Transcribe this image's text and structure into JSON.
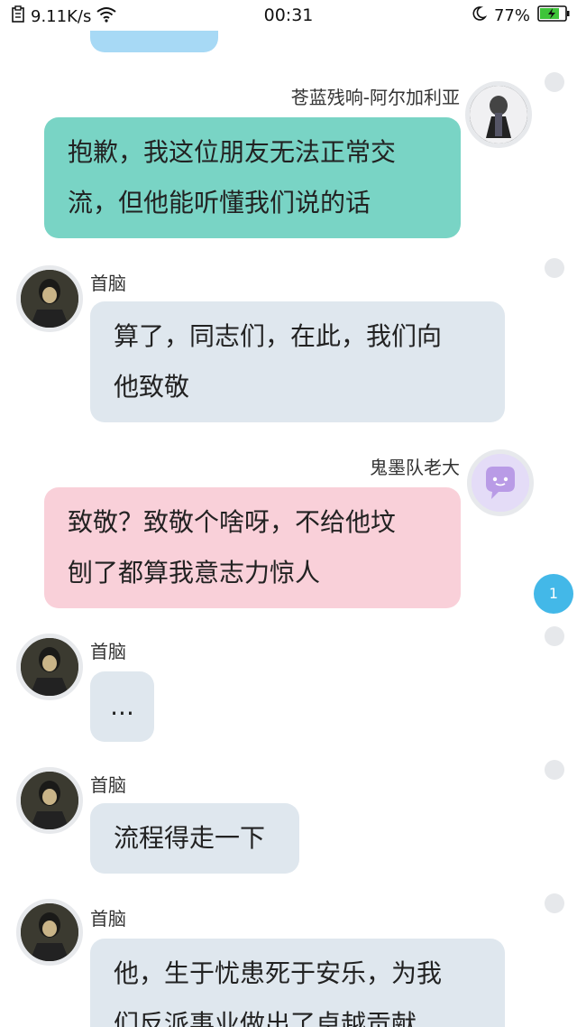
{
  "status_bar": {
    "net_speed": "9.11K/s",
    "time": "00:31",
    "battery": "77%"
  },
  "messages": [
    {
      "text": "",
      "sender": ""
    },
    {
      "sender": "苍蓝残响-阿尔加利亚",
      "line1": "抱歉，我这位朋友无法正常交",
      "line2": "流，但他能听懂我们说的话"
    },
    {
      "sender": "首脑",
      "line1": "算了，同志们，在此，我们向",
      "line2": "他致敬"
    },
    {
      "sender": "鬼墨队老大",
      "line1": "致敬？致敬个啥呀，不给他坟",
      "line2": "刨了都算我意志力惊人"
    },
    {
      "sender": "首脑",
      "line1": "..."
    },
    {
      "sender": "首脑",
      "line1": "流程得走一下"
    },
    {
      "sender": "首脑",
      "line1": "他，生于忧患死于安乐，为我",
      "line2": "们反派事业做出了卓越贡献"
    }
  ],
  "unread_badge": "1",
  "colors": {
    "teal": "#79d4c5",
    "gray": "#dfe7ee",
    "pink": "#f9d0d9",
    "badge": "#43b8e8"
  }
}
